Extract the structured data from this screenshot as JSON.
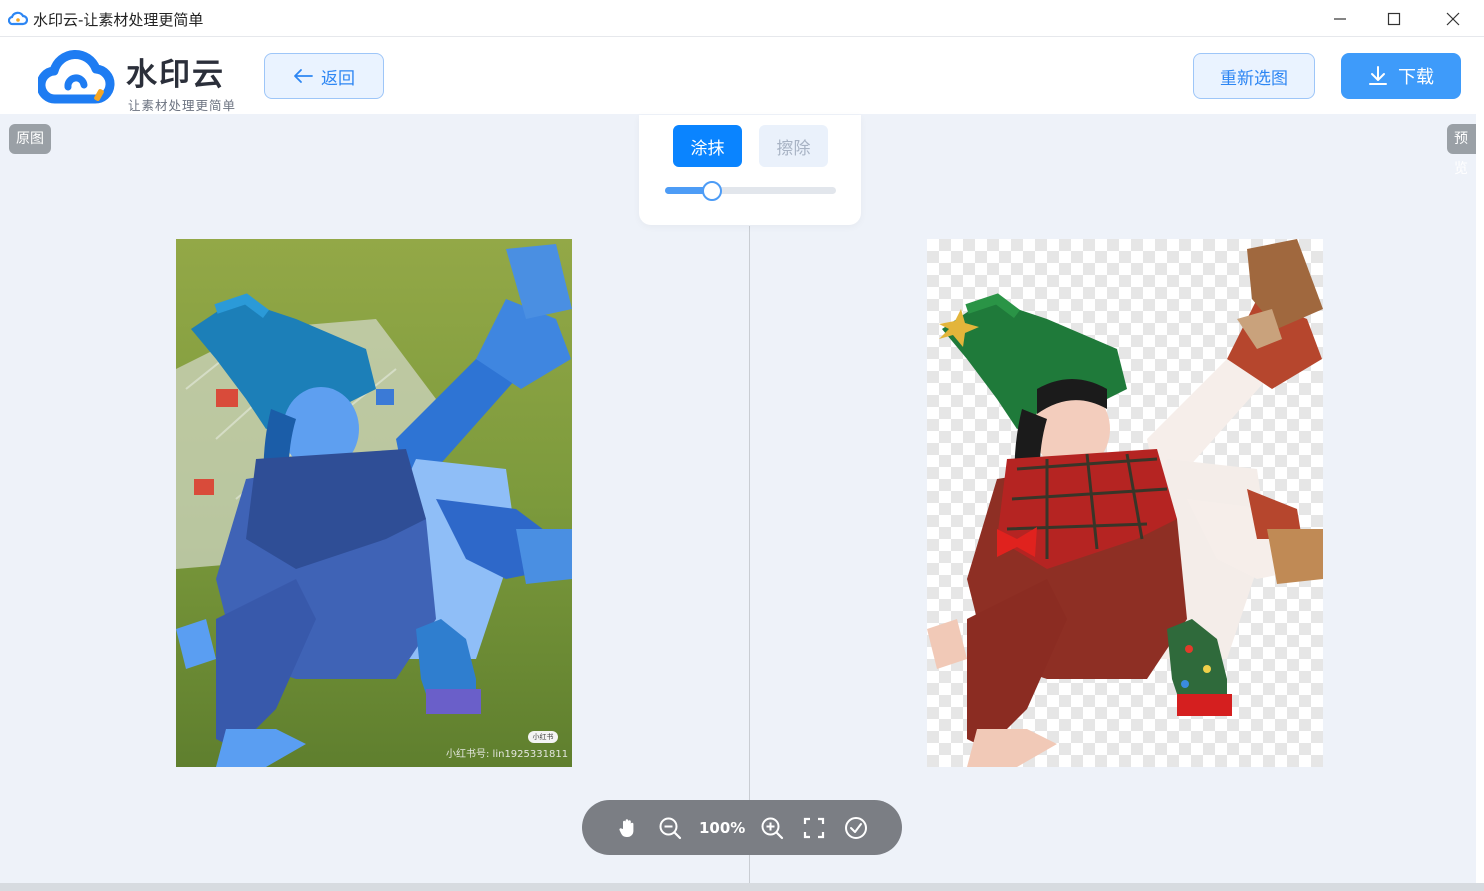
{
  "window": {
    "title": "水印云-让素材处理更简单",
    "icons": [
      "app-cloud-icon",
      "minimize-icon",
      "maximize-icon",
      "close-icon"
    ]
  },
  "header": {
    "brand": "水印云",
    "slogan": "让素材处理更简单",
    "back_label": "返回",
    "reselect_label": "重新选图",
    "download_label": "下载"
  },
  "labels": {
    "original": "原图",
    "preview": "预览"
  },
  "tool_panel": {
    "smear_label": "涂抹",
    "erase_label": "擦除",
    "active_mode": "涂抹",
    "brush_size_fraction": 0.27
  },
  "original_image": {
    "watermark_text": "小红书号: lin1925331811",
    "watermark_badge": "小红书"
  },
  "zoom_bar": {
    "zoom_level": "100%",
    "tools": [
      "hand-icon",
      "zoom-out-icon",
      "zoom-in-icon",
      "fullscreen-icon",
      "confirm-icon"
    ]
  },
  "colors": {
    "accent": "#0a84ff",
    "mask_blue": "#3e8cf0",
    "background": "#eef2f9"
  }
}
